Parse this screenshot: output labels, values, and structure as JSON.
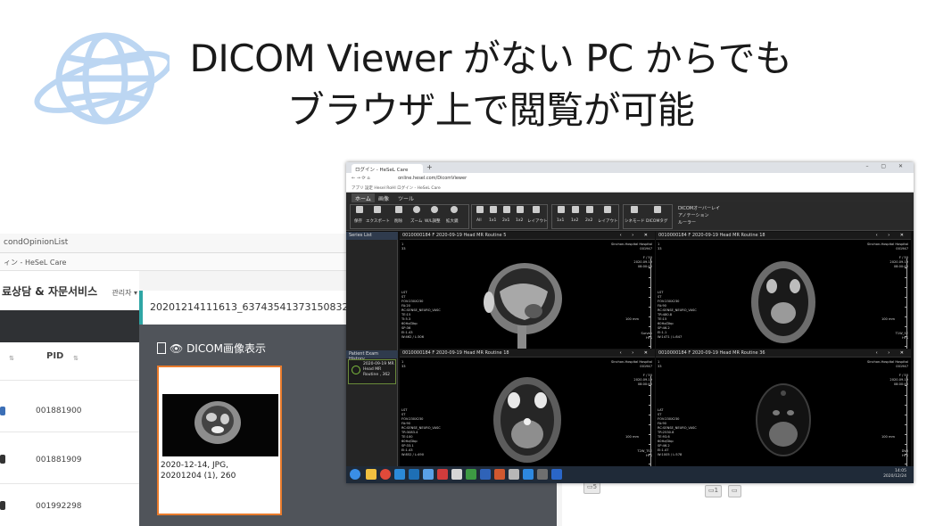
{
  "slide": {
    "headline_line1": "DICOM Viewer がない PC からでも",
    "headline_line2": "ブラウザ上で閲覧が可能",
    "globe_icon": "globe-icon",
    "globe_color": "#a9cbee"
  },
  "web_app": {
    "url_fragment": "condOpinionList",
    "bookmark_text": "ィン - HeSeL Care",
    "app_title": "료상담 & 자문서비스",
    "user_menu": "관리자 ▾",
    "file_name": "20201214111613_637435413731508324.",
    "table_header_pid": "PID",
    "table_rows": [
      {
        "pid": "001881900"
      },
      {
        "pid": "001881909"
      },
      {
        "pid": "001992298"
      }
    ],
    "dicom_panel_title": "DICOM画像表示",
    "thumbnail_caption_line1": "2020-12-14, JPG,",
    "thumbnail_caption_line2": "20201204 (1), 260",
    "accent_color": "#2fa6a5",
    "highlight_color": "#e97b2c"
  },
  "viewer": {
    "browser_tab_label": "ログイン - HeSeL Care",
    "new_tab": "+",
    "window_controls": "–  ▢  ✕",
    "address_url": "online.hesel.com/DicomViewer",
    "bookmarks": "アプリ   設定   Hesel RoHI   ログイン - HeSeL Care",
    "menu_tabs": [
      {
        "label": "ホーム",
        "active": true
      },
      {
        "label": "画像",
        "active": false
      },
      {
        "label": "ツール",
        "active": false
      }
    ],
    "tool_labels": [
      "保存",
      "エクスポート",
      "削除",
      "ズーム",
      "W/L調整",
      "拡大鏡"
    ],
    "layout_labels": [
      "All",
      "1x1",
      "2x1",
      "1x2",
      "レイアウト"
    ],
    "grid_labels": [
      "1x1",
      "1x2",
      "2x2",
      "レイアウト"
    ],
    "extra_labels": [
      "シネモード",
      "DICOMタグ"
    ],
    "options": [
      "DICOMオーバーレイ",
      "アノテーション",
      "ルーラー"
    ],
    "series_list_label": "Series List",
    "history_label": "Patient Exam History",
    "history_card": "2020-09-19 MR\nHead MR\nRoutine , 362",
    "panes": [
      {
        "title": "0010000184 F 2020-09-19 Head MR Routine 5",
        "top_right": "Sinchon-Hospital Hospital\n001947\n\nF / 50\n2020.09.19\n08:00:40",
        "bottom_left": "LST\nST\nFOV:230X230\nFA:20\nRC:SENSE_NEURO_VASC\nTE:15\nTI:5.3\n60Hz/Dbp\nSP:36\nEI:1.43\nW:462 / L:306",
        "bottom_right": "Survey\nHFS",
        "side_label": "100 mm"
      },
      {
        "title": "0010000184 F 2020-09-19 Head MR Routine 18",
        "top_right": "Sinchon-Hospital Hospital\n001947\n\nF / 50\n2020.09.19\n08:00:40",
        "bottom_left": "LST\nST\nFOV:230X230\nFA:90\nRC:SENSE_NEURO_VASC\nTR:480.8\nTE:15\n60Hz/Dbp\nSP:46.2\nEI:1.1\nW:1471 / L:847",
        "bottom_right": "T1W_SE\nHFS",
        "side_label": "100 mm"
      },
      {
        "title": "0010000184 F 2020-09-19 Head MR Routine 18",
        "top_right": "Sinchon-Hospital Hospital\n001947\n\nF / 50\n2020.09.19\n08:00:40",
        "bottom_left": "LST\nST\nFOV:230X230\nFA:90\nRC:SENSE_NEURO_VASC\nTR:3083.4\nTE:100\n60Hz/Dbp\nSP:33.1\nEI:1.43\nW:852 / L:490",
        "bottom_right": "T2W_TSE\nHFS",
        "side_label": "100 mm"
      },
      {
        "title": "0010000184 F 2020-09-19 Head MR Routine 36",
        "top_right": "Sinchon-Hospital Hospital\n001947\n\nF / 50\n2020.09.19\n08:00:40",
        "bottom_left": "LAT\nST\nFOV:230X230\nFA:90\nRC:SENSE_NEURO_VASC\nTR:2530.8\nTE:93.6\n60Hz/Dbp\nSP:46.2\nEI:1.47\nW:1005 / L:578",
        "bottom_right": "DWI\nHFS",
        "side_label": "100 mm"
      }
    ],
    "tray_time": "14:05",
    "tray_date": "2020/12/24"
  }
}
